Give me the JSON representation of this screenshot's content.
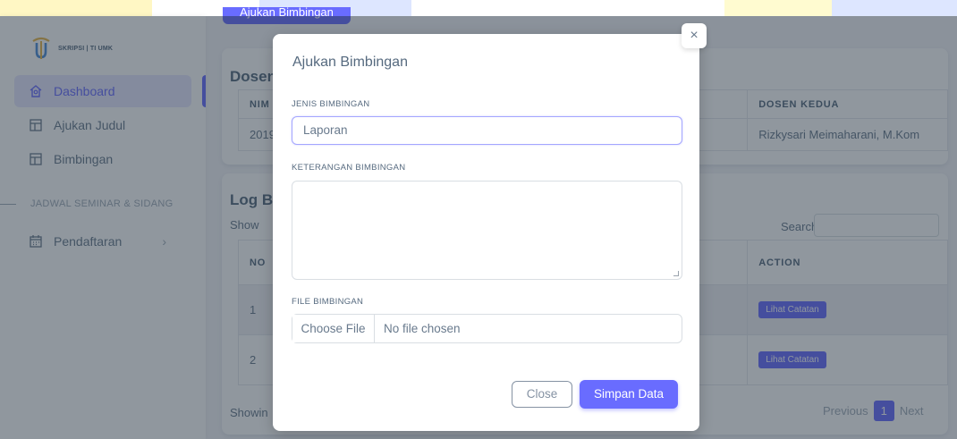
{
  "brand": {
    "text": "SKRIPSI | TI UMK"
  },
  "sidebar": {
    "items": [
      {
        "label": "Dashboard",
        "icon": "home-icon"
      },
      {
        "label": "Ajukan Judul",
        "icon": "layout-icon"
      },
      {
        "label": "Bimbingan",
        "icon": "layout-icon"
      }
    ],
    "section_header": "JADWAL SEMINAR & SIDANG",
    "section_items": [
      {
        "label": "Pendaftaran",
        "icon": "calendar-icon"
      }
    ]
  },
  "main": {
    "top_button": "Ajukan Bimbingan",
    "card1": {
      "title": "Dosen",
      "headers": [
        "NIM",
        "DOSEN KEDUA"
      ],
      "row": [
        "2019",
        "Rizkysari Meimaharani, M.Kom"
      ]
    },
    "card2": {
      "title": "Log Bi",
      "show_label": "Show",
      "search_label": "Search:",
      "headers": [
        "NO",
        "ACTION"
      ],
      "rows": [
        {
          "no": "1",
          "action": "Lihat Catatan"
        },
        {
          "no": "2",
          "action": "Lihat Catatan"
        }
      ],
      "showing": "Showin",
      "pager": {
        "prev": "Previous",
        "current": "1",
        "next": "Next"
      }
    }
  },
  "modal": {
    "title": "Ajukan Bimbingan",
    "close_symbol": "×",
    "fields": {
      "jenis_label": "JENIS BIMBINGAN",
      "jenis_value": "Laporan",
      "keterangan_label": "KETERANGAN BIMBINGAN",
      "file_label": "FILE BIMBINGAN",
      "file_button": "Choose File",
      "file_status": "No file chosen"
    },
    "buttons": {
      "close": "Close",
      "save": "Simpan Data"
    }
  },
  "colors": {
    "primary": "#696cff",
    "text": "#566a7f",
    "overlay": "rgba(34,48,62,0.5)"
  }
}
